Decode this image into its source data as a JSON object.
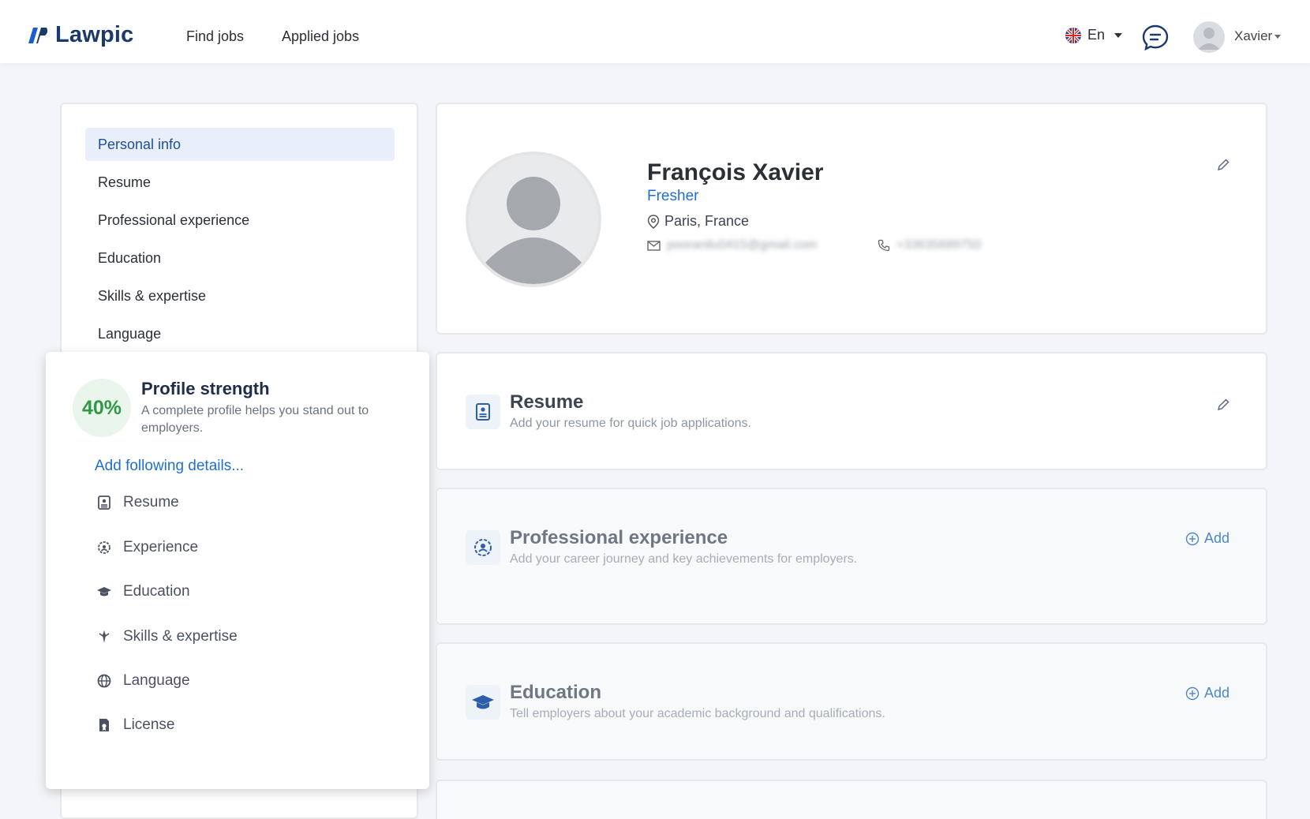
{
  "header": {
    "brand": "Lawpic",
    "nav": [
      "Find jobs",
      "Applied jobs"
    ],
    "language": "En",
    "user_name": "Xavier"
  },
  "sidebar": {
    "items": [
      {
        "label": "Personal info",
        "active": true
      },
      {
        "label": "Resume"
      },
      {
        "label": "Professional experience"
      },
      {
        "label": "Education"
      },
      {
        "label": "Skills & expertise"
      },
      {
        "label": "Language"
      }
    ]
  },
  "strength": {
    "percent_label": "40%",
    "percent": 40,
    "title": "Profile strength",
    "description": "A complete profile helps you stand out to employers.",
    "add_details": "Add following details...",
    "items": [
      {
        "label": "Resume",
        "icon": "resume-icon"
      },
      {
        "label": "Experience",
        "icon": "experience-icon"
      },
      {
        "label": "Education",
        "icon": "graduation-cap-icon"
      },
      {
        "label": "Skills & expertise",
        "icon": "skills-icon"
      },
      {
        "label": "Language",
        "icon": "globe-icon"
      },
      {
        "label": "License",
        "icon": "license-icon"
      }
    ]
  },
  "profile": {
    "name": "François Xavier",
    "status": "Fresher",
    "location": "Paris, France",
    "email": "pooranilu0415@gmail.com",
    "phone": "+33635689750"
  },
  "sections": [
    {
      "title": "Resume",
      "description": "Add your resume for quick job applications.",
      "action": "edit"
    },
    {
      "title": "Professional experience",
      "description": "Add your career journey and key achievements for employers.",
      "action_label": "Add"
    },
    {
      "title": "Education",
      "description": "Tell employers about your academic background and qualifications.",
      "action_label": "Add"
    }
  ],
  "colors": {
    "brand": "#1a3a6b",
    "accent": "#1f6fd0",
    "strength_green": "#2e9a46",
    "active_bg": "#e9eefb"
  }
}
